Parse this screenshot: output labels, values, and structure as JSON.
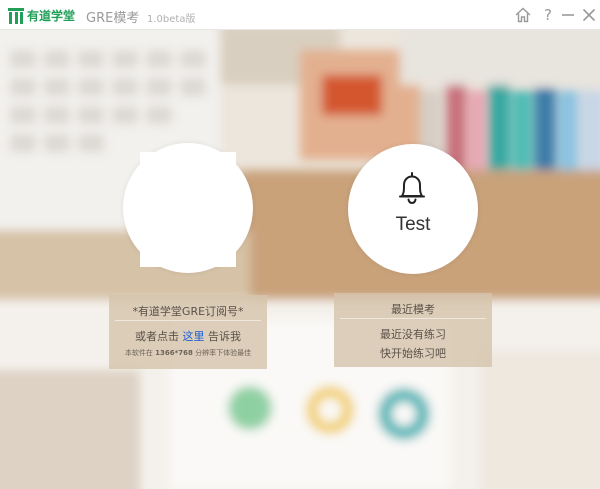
{
  "window": {
    "brand": "有道学堂",
    "app_name": "GRE模考",
    "version": "1.0beta版",
    "help_glyph": "?"
  },
  "left_card": {
    "title": "*有道学堂GRE订阅号*",
    "line_prefix": "或者点击",
    "link_text": "这里",
    "line_suffix": "告诉我",
    "note_prefix": "本软件在",
    "note_resolution": "1366*768",
    "note_suffix": "分辨率下体验最佳"
  },
  "right_card": {
    "circle_label": "Test",
    "title": "最近模考",
    "line1": "最近没有练习",
    "line2": "快开始练习吧"
  },
  "colors": {
    "brand": "#22a05a",
    "link": "#1a5fd6",
    "panel": "#d6c4ac"
  },
  "icons": [
    "youdao-logo-icon",
    "home-icon",
    "help-icon",
    "minimize-icon",
    "close-icon",
    "bell-icon"
  ]
}
